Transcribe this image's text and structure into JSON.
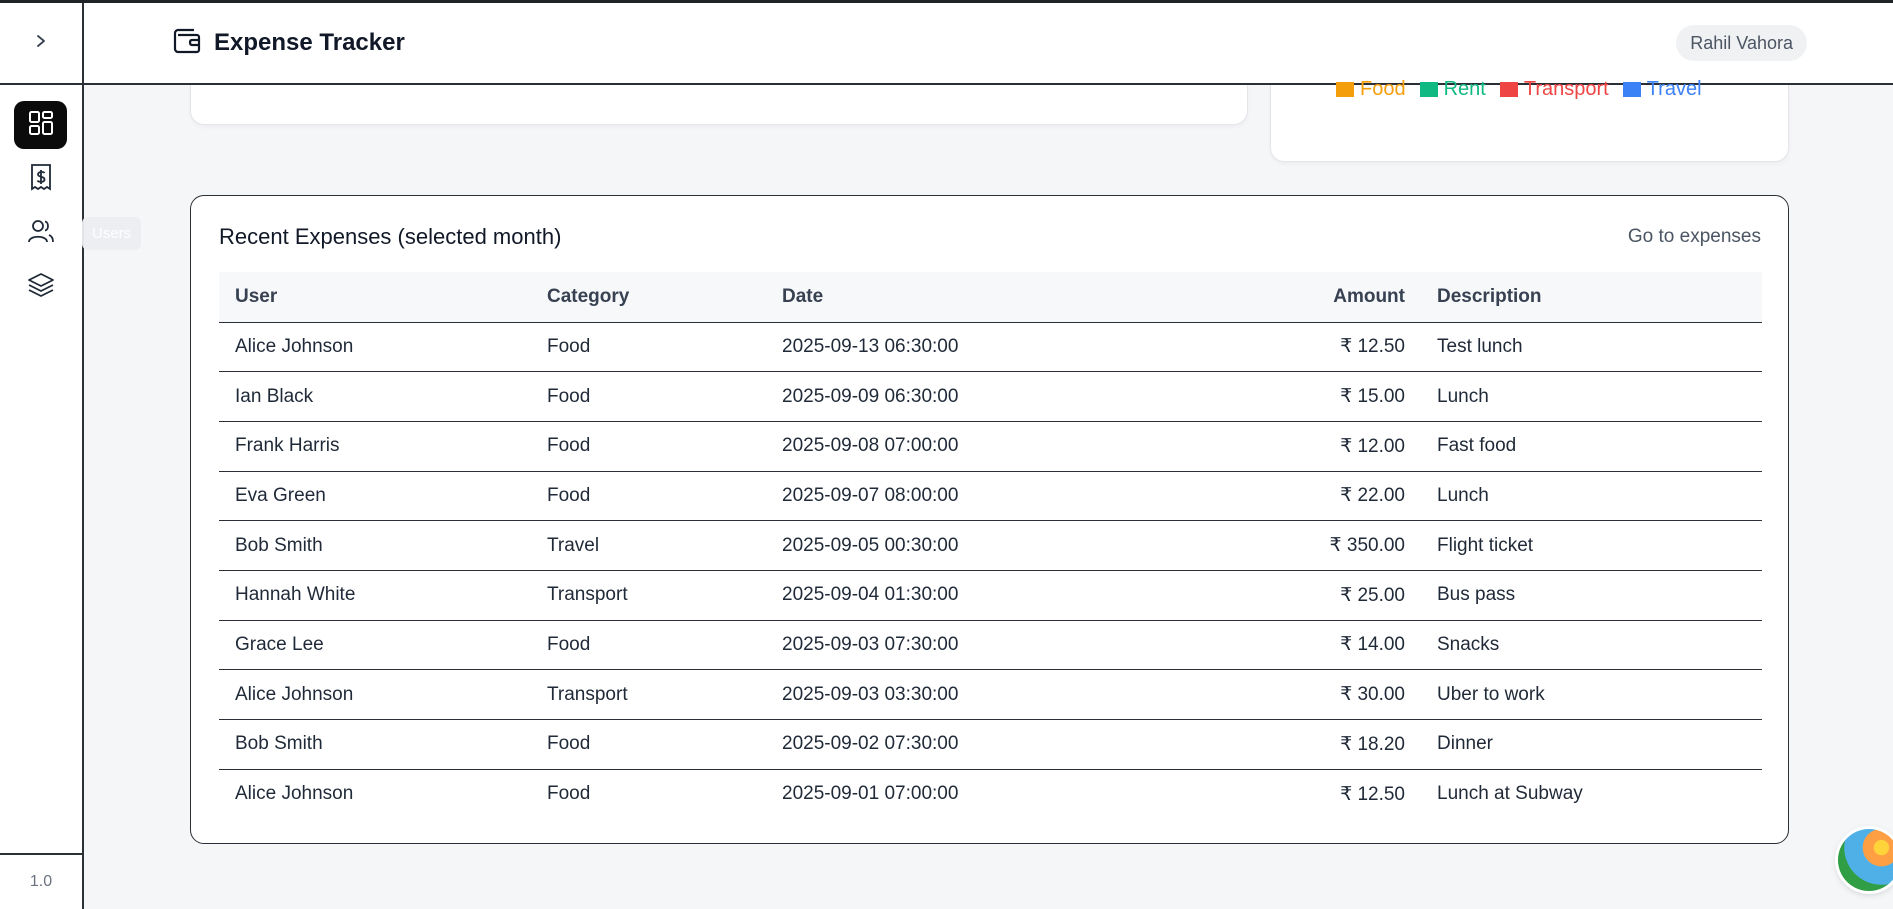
{
  "app": {
    "title": "Expense Tracker",
    "user_name": "Rahil Vahora",
    "version": "1.0"
  },
  "sidebar": {
    "toggle_icon": "chevron-right-icon",
    "items": [
      {
        "icon": "dashboard-icon",
        "active": true
      },
      {
        "icon": "receipt-dollar-icon",
        "active": false
      },
      {
        "icon": "users-icon",
        "active": false
      },
      {
        "icon": "layers-icon",
        "active": false
      }
    ],
    "tooltip": "Users"
  },
  "chart_legend": [
    {
      "label": "Food",
      "color": "#f59e0b"
    },
    {
      "label": "Rent",
      "color": "#10b981"
    },
    {
      "label": "Transport",
      "color": "#ef4444"
    },
    {
      "label": "Travel",
      "color": "#3b82f6"
    }
  ],
  "recent_expenses": {
    "title": "Recent Expenses (selected month)",
    "link_label": "Go to expenses",
    "columns": [
      "User",
      "Category",
      "Date",
      "Amount",
      "Description"
    ],
    "rows": [
      [
        "Alice Johnson",
        "Food",
        "2025-09-13 06:30:00",
        "₹ 12.50",
        "Test lunch"
      ],
      [
        "Ian Black",
        "Food",
        "2025-09-09 06:30:00",
        "₹ 15.00",
        "Lunch"
      ],
      [
        "Frank Harris",
        "Food",
        "2025-09-08 07:00:00",
        "₹ 12.00",
        "Fast food"
      ],
      [
        "Eva Green",
        "Food",
        "2025-09-07 08:00:00",
        "₹ 22.00",
        "Lunch"
      ],
      [
        "Bob Smith",
        "Travel",
        "2025-09-05 00:30:00",
        "₹ 350.00",
        "Flight ticket"
      ],
      [
        "Hannah White",
        "Transport",
        "2025-09-04 01:30:00",
        "₹ 25.00",
        "Bus pass"
      ],
      [
        "Grace Lee",
        "Food",
        "2025-09-03 07:30:00",
        "₹ 14.00",
        "Snacks"
      ],
      [
        "Alice Johnson",
        "Transport",
        "2025-09-03 03:30:00",
        "₹ 30.00",
        "Uber to work"
      ],
      [
        "Bob Smith",
        "Food",
        "2025-09-02 07:30:00",
        "₹ 18.20",
        "Dinner"
      ],
      [
        "Alice Johnson",
        "Food",
        "2025-09-01 07:00:00",
        "₹ 12.50",
        "Lunch at Subway"
      ]
    ]
  }
}
